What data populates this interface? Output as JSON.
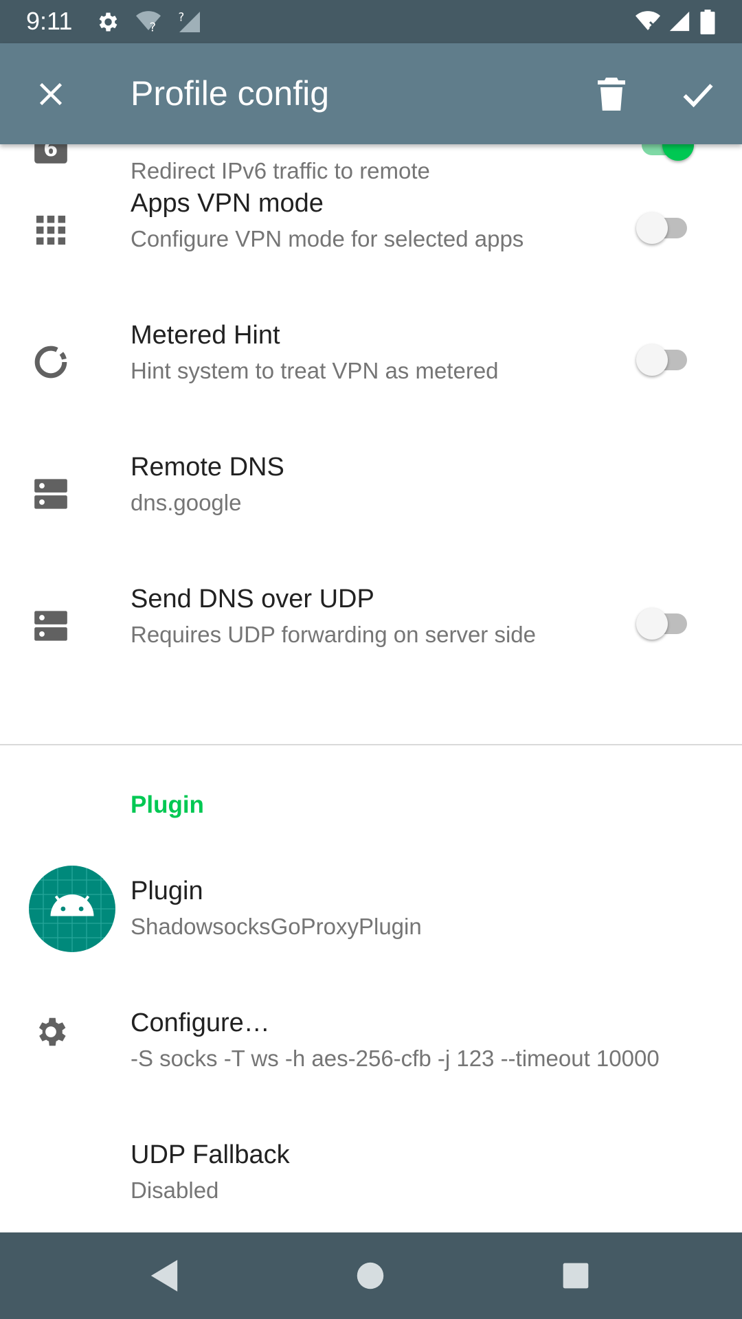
{
  "status_bar": {
    "time": "9:11",
    "icons": [
      "settings-icon",
      "wifi-question-icon",
      "signal-question-icon",
      "wifi-x-icon",
      "cell-signal-icon",
      "battery-icon"
    ]
  },
  "app_bar": {
    "title": "Profile config",
    "close_icon": "close-icon",
    "delete_icon": "delete-icon",
    "save_icon": "check-icon"
  },
  "colors": {
    "status_bar": "#455a64",
    "app_bar": "#607d8b",
    "accent": "#00c853",
    "nav_bar": "#455a64"
  },
  "items": [
    {
      "subtitle": "Redirect IPv6 traffic to remote",
      "icon": "ipv6-icon",
      "switch": true
    },
    {
      "title": "Apps VPN mode",
      "subtitle": "Configure VPN mode for selected apps",
      "icon": "apps-grid-icon",
      "switch": false
    },
    {
      "title": "Metered Hint",
      "subtitle": "Hint system to treat VPN as metered",
      "icon": "data-usage-icon",
      "switch": false
    },
    {
      "title": "Remote DNS",
      "subtitle": "dns.google",
      "icon": "dns-server-icon"
    },
    {
      "title": "Send DNS over UDP",
      "subtitle": "Requires UDP forwarding on server side",
      "icon": "dns-server-icon",
      "switch": false
    }
  ],
  "plugin_section": {
    "header": "Plugin",
    "items": [
      {
        "title": "Plugin",
        "subtitle": "ShadowsocksGoProxyPlugin",
        "icon": "android-app-icon"
      },
      {
        "title": "Configure…",
        "subtitle": "-S socks -T ws -h aes-256-cfb -j 123 --timeout 10000",
        "icon": "gear-icon"
      },
      {
        "title": "UDP Fallback",
        "subtitle": "Disabled"
      }
    ]
  },
  "nav_bar": {
    "icons": [
      "back-icon",
      "home-icon",
      "recents-icon"
    ]
  }
}
